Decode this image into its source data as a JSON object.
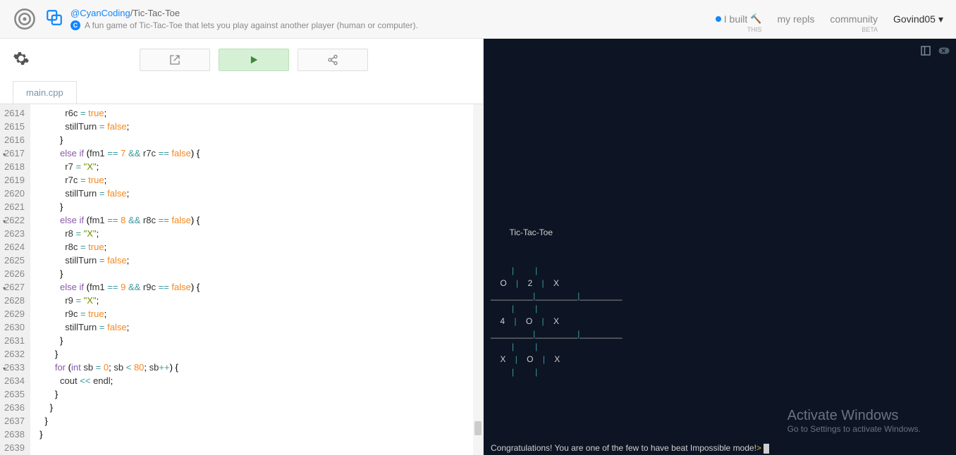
{
  "header": {
    "author": "@CyanCoding",
    "name": "/Tic-Tac-Toe",
    "desc": "A fun game of Tic-Tac-Toe that lets you play against another player (human or computer).",
    "nav": {
      "built": "I built",
      "built_sub": "THIS",
      "myrepls": "my repls",
      "community": "community",
      "community_sub": "BETA"
    },
    "user": "Govind05"
  },
  "tabs": [
    "main.cpp"
  ],
  "gutter_start": 2614,
  "gutter_end": 2639,
  "fold_lines": [
    2617,
    2622,
    2627,
    2633
  ],
  "code_lines": [
    [
      [
        "",
        "            "
      ],
      [
        "id",
        "r6c"
      ],
      [
        "",
        " "
      ],
      [
        "op",
        "="
      ],
      [
        "",
        " "
      ],
      [
        "bool",
        "true"
      ],
      [
        "",
        ";"
      ]
    ],
    [
      [
        "",
        "            "
      ],
      [
        "id",
        "stillTurn"
      ],
      [
        "",
        " "
      ],
      [
        "op",
        "="
      ],
      [
        "",
        " "
      ],
      [
        "bool",
        "false"
      ],
      [
        "",
        ";"
      ]
    ],
    [
      [
        "",
        "          }"
      ]
    ],
    [
      [
        "",
        "          "
      ],
      [
        "kw",
        "else"
      ],
      [
        "",
        " "
      ],
      [
        "kw",
        "if"
      ],
      [
        "",
        " ("
      ],
      [
        "id",
        "fm1"
      ],
      [
        "",
        " "
      ],
      [
        "op",
        "=="
      ],
      [
        "",
        " "
      ],
      [
        "num",
        "7"
      ],
      [
        "",
        " "
      ],
      [
        "op",
        "&&"
      ],
      [
        "",
        " "
      ],
      [
        "id",
        "r7c"
      ],
      [
        "",
        " "
      ],
      [
        "op",
        "=="
      ],
      [
        "",
        " "
      ],
      [
        "bool",
        "false"
      ],
      [
        "",
        ") {"
      ]
    ],
    [
      [
        "",
        "            "
      ],
      [
        "id",
        "r7"
      ],
      [
        "",
        " "
      ],
      [
        "op",
        "="
      ],
      [
        "",
        " "
      ],
      [
        "str",
        "\"X\""
      ],
      [
        "",
        ";"
      ]
    ],
    [
      [
        "",
        "            "
      ],
      [
        "id",
        "r7c"
      ],
      [
        "",
        " "
      ],
      [
        "op",
        "="
      ],
      [
        "",
        " "
      ],
      [
        "bool",
        "true"
      ],
      [
        "",
        ";"
      ]
    ],
    [
      [
        "",
        "            "
      ],
      [
        "id",
        "stillTurn"
      ],
      [
        "",
        " "
      ],
      [
        "op",
        "="
      ],
      [
        "",
        " "
      ],
      [
        "bool",
        "false"
      ],
      [
        "",
        ";"
      ]
    ],
    [
      [
        "",
        "          }"
      ]
    ],
    [
      [
        "",
        "          "
      ],
      [
        "kw",
        "else"
      ],
      [
        "",
        " "
      ],
      [
        "kw",
        "if"
      ],
      [
        "",
        " ("
      ],
      [
        "id",
        "fm1"
      ],
      [
        "",
        " "
      ],
      [
        "op",
        "=="
      ],
      [
        "",
        " "
      ],
      [
        "num",
        "8"
      ],
      [
        "",
        " "
      ],
      [
        "op",
        "&&"
      ],
      [
        "",
        " "
      ],
      [
        "id",
        "r8c"
      ],
      [
        "",
        " "
      ],
      [
        "op",
        "=="
      ],
      [
        "",
        " "
      ],
      [
        "bool",
        "false"
      ],
      [
        "",
        ") {"
      ]
    ],
    [
      [
        "",
        "            "
      ],
      [
        "id",
        "r8"
      ],
      [
        "",
        " "
      ],
      [
        "op",
        "="
      ],
      [
        "",
        " "
      ],
      [
        "str",
        "\"X\""
      ],
      [
        "",
        ";"
      ]
    ],
    [
      [
        "",
        "            "
      ],
      [
        "id",
        "r8c"
      ],
      [
        "",
        " "
      ],
      [
        "op",
        "="
      ],
      [
        "",
        " "
      ],
      [
        "bool",
        "true"
      ],
      [
        "",
        ";"
      ]
    ],
    [
      [
        "",
        "            "
      ],
      [
        "id",
        "stillTurn"
      ],
      [
        "",
        " "
      ],
      [
        "op",
        "="
      ],
      [
        "",
        " "
      ],
      [
        "bool",
        "false"
      ],
      [
        "",
        ";"
      ]
    ],
    [
      [
        "",
        "          }"
      ]
    ],
    [
      [
        "",
        "          "
      ],
      [
        "kw",
        "else"
      ],
      [
        "",
        " "
      ],
      [
        "kw",
        "if"
      ],
      [
        "",
        " ("
      ],
      [
        "id",
        "fm1"
      ],
      [
        "",
        " "
      ],
      [
        "op",
        "=="
      ],
      [
        "",
        " "
      ],
      [
        "num",
        "9"
      ],
      [
        "",
        " "
      ],
      [
        "op",
        "&&"
      ],
      [
        "",
        " "
      ],
      [
        "id",
        "r9c"
      ],
      [
        "",
        " "
      ],
      [
        "op",
        "=="
      ],
      [
        "",
        " "
      ],
      [
        "bool",
        "false"
      ],
      [
        "",
        ") {"
      ]
    ],
    [
      [
        "",
        "            "
      ],
      [
        "id",
        "r9"
      ],
      [
        "",
        " "
      ],
      [
        "op",
        "="
      ],
      [
        "",
        " "
      ],
      [
        "str",
        "\"X\""
      ],
      [
        "",
        ";"
      ]
    ],
    [
      [
        "",
        "            "
      ],
      [
        "id",
        "r9c"
      ],
      [
        "",
        " "
      ],
      [
        "op",
        "="
      ],
      [
        "",
        " "
      ],
      [
        "bool",
        "true"
      ],
      [
        "",
        ";"
      ]
    ],
    [
      [
        "",
        "            "
      ],
      [
        "id",
        "stillTurn"
      ],
      [
        "",
        " "
      ],
      [
        "op",
        "="
      ],
      [
        "",
        " "
      ],
      [
        "bool",
        "false"
      ],
      [
        "",
        ";"
      ]
    ],
    [
      [
        "",
        "          }"
      ]
    ],
    [
      [
        "",
        "        }"
      ]
    ],
    [
      [
        "",
        "        "
      ],
      [
        "kw",
        "for"
      ],
      [
        "",
        " ("
      ],
      [
        "kw",
        "int"
      ],
      [
        "",
        " "
      ],
      [
        "id",
        "sb"
      ],
      [
        "",
        " "
      ],
      [
        "op",
        "="
      ],
      [
        "",
        " "
      ],
      [
        "num",
        "0"
      ],
      [
        "",
        "; "
      ],
      [
        "id",
        "sb"
      ],
      [
        "",
        " "
      ],
      [
        "op",
        "<"
      ],
      [
        "",
        " "
      ],
      [
        "num",
        "80"
      ],
      [
        "",
        "; "
      ],
      [
        "id",
        "sb"
      ],
      [
        "op",
        "++"
      ],
      [
        "",
        ") {"
      ]
    ],
    [
      [
        "",
        "          "
      ],
      [
        "id",
        "cout"
      ],
      [
        "",
        " "
      ],
      [
        "op",
        "<<"
      ],
      [
        "",
        " "
      ],
      [
        "id",
        "endl"
      ],
      [
        "",
        ";"
      ]
    ],
    [
      [
        "",
        "        }"
      ]
    ],
    [
      [
        "",
        "      }"
      ]
    ],
    [
      [
        "",
        "    }"
      ]
    ],
    [
      [
        "",
        "  }"
      ]
    ],
    [
      [
        "",
        ""
      ]
    ]
  ],
  "terminal": {
    "title": "Tic-Tac-Toe",
    "board": [
      [
        "O",
        "2",
        "X"
      ],
      [
        "4",
        "O",
        "X"
      ],
      [
        "X",
        "O",
        "X"
      ]
    ],
    "msg": "Congratulations! You are one of the few to have beat Impossible mode!",
    "prompt": "> "
  },
  "watermark": {
    "line1": "Activate Windows",
    "line2": "Go to Settings to activate Windows."
  }
}
